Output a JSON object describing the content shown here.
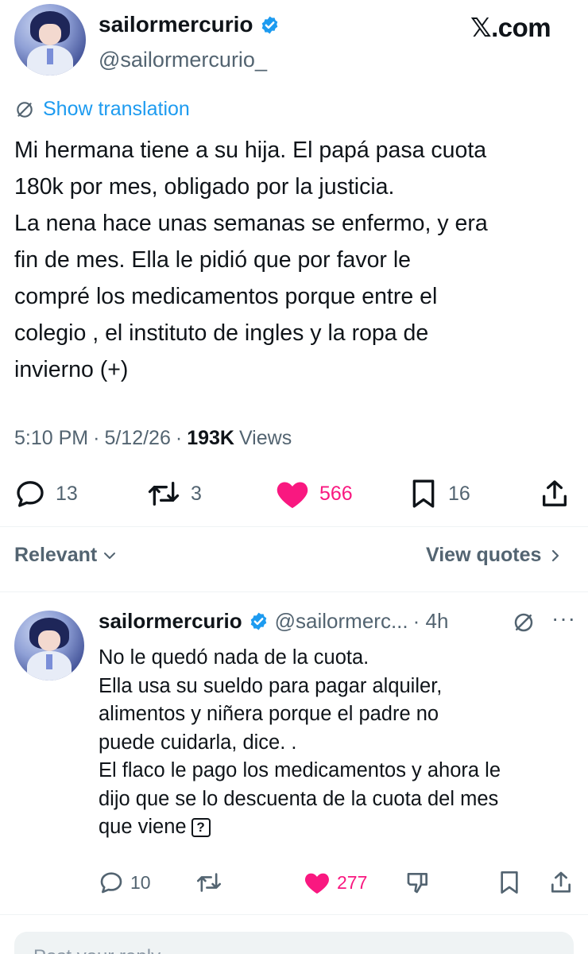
{
  "header": {
    "name": "sailormercurio",
    "handle": "@sailormercurio_",
    "site": "𝕏.com"
  },
  "translate": {
    "label": "Show translation"
  },
  "tweet": {
    "lines": [
      "Mi hermana tiene a su hija. El papá pasa cuota",
      "180k por mes, obligado por la justicia.",
      "La nena hace unas semanas se enfermo, y era",
      "fin de mes. Ella le pidió que por favor le",
      "compré los medicamentos porque entre el",
      "colegio , el instituto de ingles y la ropa de",
      "invierno (+)"
    ],
    "time": "5:10 PM",
    "date": "5/12/26",
    "sep": "·",
    "views_count": "193K",
    "views_label": "Views"
  },
  "actions": {
    "replies": "13",
    "reposts": "3",
    "likes": "566",
    "bookmarks": "16"
  },
  "sort": {
    "relevant": "Relevant",
    "view_quotes": "View quotes"
  },
  "reply": {
    "name": "sailormercurio",
    "handle": "@sailormerc...",
    "time": "· 4h",
    "more": "···",
    "lines": [
      "No le quedó nada de la cuota.",
      "Ella usa su sueldo para pagar alquiler,",
      "alimentos y niñera porque el padre no",
      "puede cuidarla, dice. .",
      "El flaco le pago los medicamentos y ahora le",
      "dijo que se lo descuenta de la cuota del mes",
      "que viene"
    ],
    "emoji_placeholder": "?",
    "actions": {
      "replies": "10",
      "likes": "277"
    }
  },
  "composer": {
    "placeholder": "Post your reply"
  },
  "colors": {
    "accent": "#1d9bf0",
    "like": "#f91880",
    "text": "#0f1419",
    "secondary": "#536471"
  },
  "icons": [
    "verified-badge-icon",
    "translate-icon",
    "reply-icon",
    "repost-icon",
    "like-icon",
    "bookmark-icon",
    "share-icon",
    "chevron-down-icon",
    "chevron-right-icon",
    "grok-icon",
    "more-icon",
    "dislike-icon"
  ]
}
